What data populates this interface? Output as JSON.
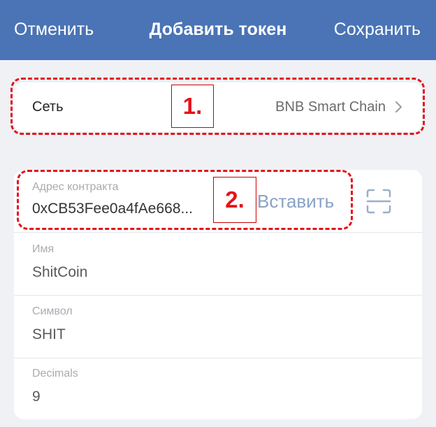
{
  "nav": {
    "cancel": "Отменить",
    "title": "Добавить токен",
    "save": "Сохранить"
  },
  "network": {
    "label": "Сеть",
    "value": "BNB Smart Chain",
    "chevron_icon": "chevron-right-icon"
  },
  "contract": {
    "label": "Адрес контракта",
    "value": "0xCB53Fee0a4fAe668...",
    "paste_label": "Вставить",
    "scan_icon": "qr-scan-icon"
  },
  "fields": {
    "name": {
      "label": "Имя",
      "value": "ShitCoin"
    },
    "symbol": {
      "label": "Символ",
      "value": "SHIT"
    },
    "decimals": {
      "label": "Decimals",
      "value": "9"
    }
  },
  "annotations": {
    "first": "1.",
    "second": "2."
  },
  "colors": {
    "nav_bg": "#4a74b5",
    "page_bg": "#eff1f5",
    "annotation": "#e4121b",
    "paste_link": "#8aa2c4"
  }
}
